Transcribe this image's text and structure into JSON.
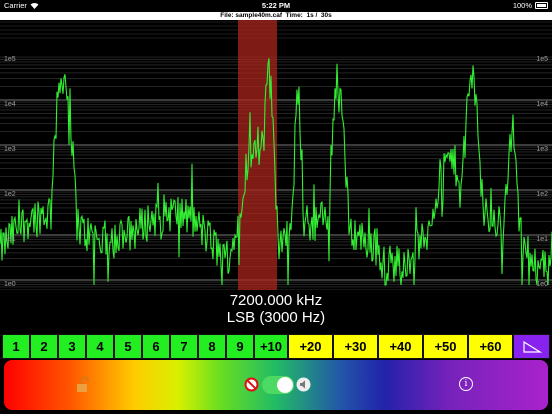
{
  "status_bar": {
    "carrier": "Carrier",
    "time": "5:22 PM",
    "battery": "100%"
  },
  "file_bar": {
    "text": "File: sample40m.caf  Time:  1s /  30s"
  },
  "spectrum": {
    "scale_labels": [
      "1e5",
      "1e4",
      "1e3",
      "1e2",
      "1e1",
      "1e0"
    ],
    "trace_color": "#33ee33",
    "marker_color": "#b3261e"
  },
  "readout": {
    "frequency": "7200.000 kHz",
    "mode": "LSB (3000 Hz)"
  },
  "step_buttons": [
    {
      "label": "1",
      "color": "green"
    },
    {
      "label": "2",
      "color": "green"
    },
    {
      "label": "3",
      "color": "green"
    },
    {
      "label": "4",
      "color": "green"
    },
    {
      "label": "5",
      "color": "green"
    },
    {
      "label": "6",
      "color": "green"
    },
    {
      "label": "7",
      "color": "green"
    },
    {
      "label": "8",
      "color": "green"
    },
    {
      "label": "9",
      "color": "green"
    },
    {
      "label": "+10",
      "color": "green"
    },
    {
      "label": "+20",
      "color": "yellow"
    },
    {
      "label": "+30",
      "color": "yellow"
    },
    {
      "label": "+40",
      "color": "yellow"
    },
    {
      "label": "+50",
      "color": "yellow"
    },
    {
      "label": "+60",
      "color": "yellow"
    }
  ],
  "controls": {
    "lock_icon": "unlocked-padlock-icon",
    "mute_icon": "no-sign-icon",
    "toggle_on": true,
    "speaker_icon": "speaker-icon",
    "info_label": "i"
  }
}
